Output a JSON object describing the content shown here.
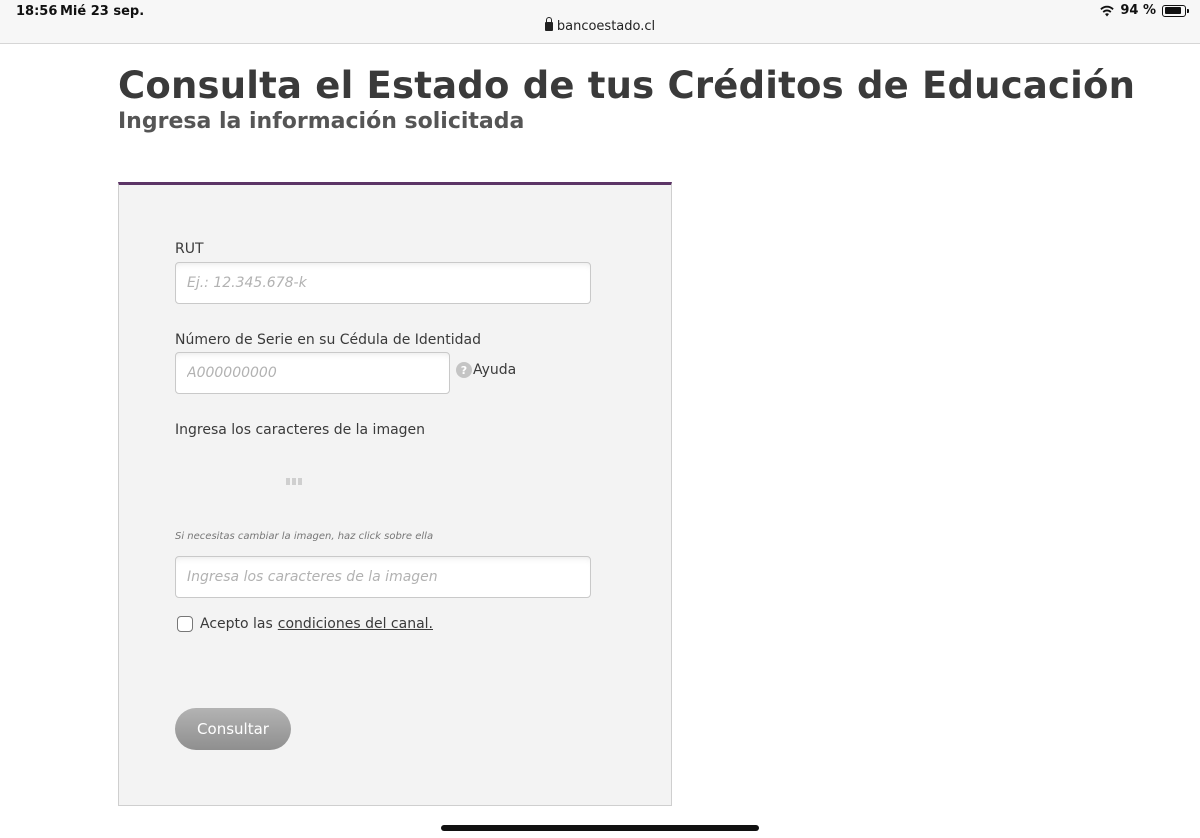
{
  "status_bar": {
    "time": "18:56",
    "date": "Mié 23 sep.",
    "battery_text": "94 %",
    "battery_level": 0.94
  },
  "browser": {
    "url": "bancoestado.cl"
  },
  "header": {
    "title": "Consulta el Estado de tus Créditos de Educación",
    "subtitle": "Ingresa la información solicitada"
  },
  "form": {
    "accent_color": "#5c3566",
    "rut": {
      "label": "RUT",
      "value": "",
      "placeholder": "Ej.: 12.345.678-k"
    },
    "serie": {
      "label": "Número de Serie en su Cédula de Identidad",
      "value": "",
      "placeholder": "A000000000"
    },
    "help": {
      "icon": "question-icon",
      "label": "Ayuda"
    },
    "captcha": {
      "label": "Ingresa los caracteres de la imagen",
      "hint": "Si necesitas cambiar la imagen, haz click sobre ella",
      "value": "",
      "placeholder": "Ingresa los caracteres de la imagen"
    },
    "terms": {
      "checked": false,
      "prefix": "Acepto las",
      "link": "condiciones del canal."
    },
    "submit_label": "Consultar"
  }
}
